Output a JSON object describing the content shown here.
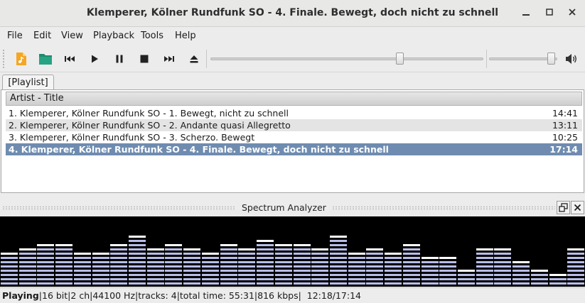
{
  "window": {
    "title": "Klemperer, Kölner Rundfunk SO - 4. Finale. Bewegt, doch nicht zu schnell"
  },
  "menu": [
    "File",
    "Edit",
    "View",
    "Playback",
    "Tools",
    "Help"
  ],
  "toolbar": {
    "icons": [
      "open-file-icon",
      "open-folder-icon",
      "previous-icon",
      "play-icon",
      "pause-icon",
      "stop-icon",
      "next-icon",
      "eject-icon",
      "volume-icon"
    ],
    "seek_position": 0.7,
    "volume_level": 0.97
  },
  "tabs": [
    "[Playlist]"
  ],
  "playlist": {
    "column_header": "Artist - Title",
    "rows": [
      {
        "title": "1. Klemperer, Kölner Rundfunk SO - 1. Bewegt, nicht zu schnell",
        "duration": "14:41"
      },
      {
        "title": "2. Klemperer, Kölner Rundfunk SO - 2. Andante quasi Allegretto",
        "duration": "13:11"
      },
      {
        "title": "3. Klemperer, Kölner Rundfunk SO - 3. Scherzo. Bewegt",
        "duration": "10:25"
      },
      {
        "title": "4. Klemperer, Kölner Rundfunk SO - 4. Finale. Bewegt, doch nicht zu schnell",
        "duration": "17:14"
      }
    ],
    "selected_index": 3
  },
  "dock": {
    "title": "Spectrum Analyzer"
  },
  "spectrum": {
    "bar_color": "#b8bde8",
    "peak_color": "#ffffff",
    "levels": [
      8,
      9,
      10,
      10,
      8,
      8,
      10,
      12,
      9,
      10,
      9,
      8,
      10,
      9,
      11,
      10,
      10,
      9,
      12,
      8,
      9,
      8,
      10,
      7,
      7,
      4,
      9,
      9,
      6,
      4,
      3,
      9
    ]
  },
  "status": {
    "state": "Playing",
    "info": "|16 bit|2 ch|44100 Hz|tracks: 4|total time: 55:31|816 kbps|",
    "time": "12:18/17:14"
  },
  "colors": {
    "selection": "#6f8cb0",
    "accent_icon": "#f5a623",
    "folder_icon": "#1f8a70"
  }
}
